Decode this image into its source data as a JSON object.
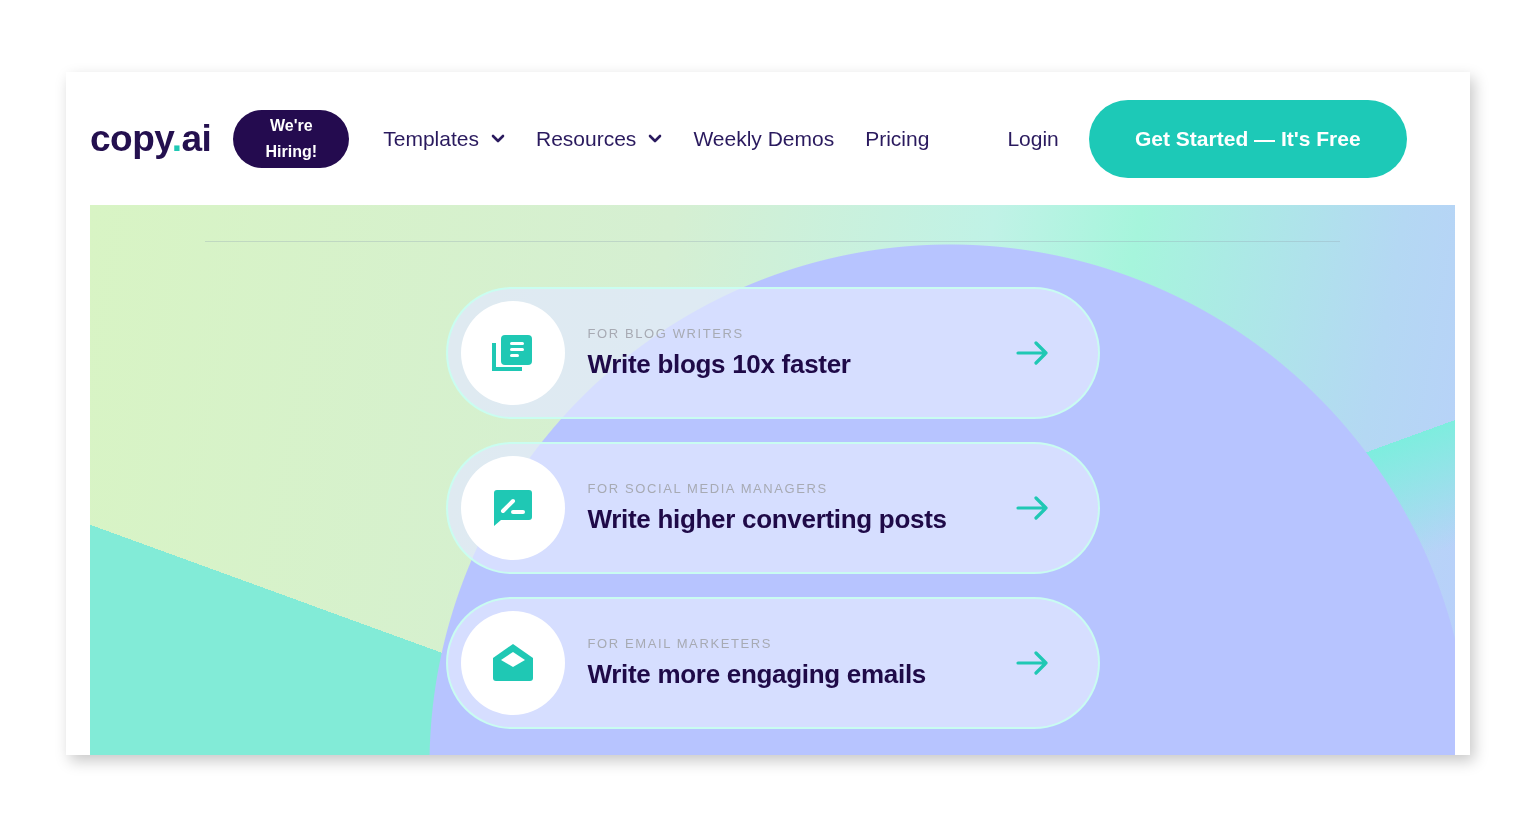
{
  "header": {
    "logo_parts": [
      "copy",
      ".",
      "ai"
    ],
    "hiring_badge": [
      "We're",
      "Hiring!"
    ],
    "nav": [
      {
        "label": "Templates",
        "dropdown": true
      },
      {
        "label": "Resources",
        "dropdown": true
      },
      {
        "label": "Weekly Demos",
        "dropdown": false
      },
      {
        "label": "Pricing",
        "dropdown": false
      }
    ],
    "login": "Login",
    "cta": "Get Started — It's Free"
  },
  "audiences": [
    {
      "kind": "blog",
      "eyebrow": "FOR BLOG WRITERS",
      "title": "Write blogs 10x faster"
    },
    {
      "kind": "social",
      "eyebrow": "FOR SOCIAL MEDIA MANAGERS",
      "title": "Write higher converting posts"
    },
    {
      "kind": "email",
      "eyebrow": "FOR EMAIL MARKETERS",
      "title": "Write more engaging emails"
    }
  ]
}
